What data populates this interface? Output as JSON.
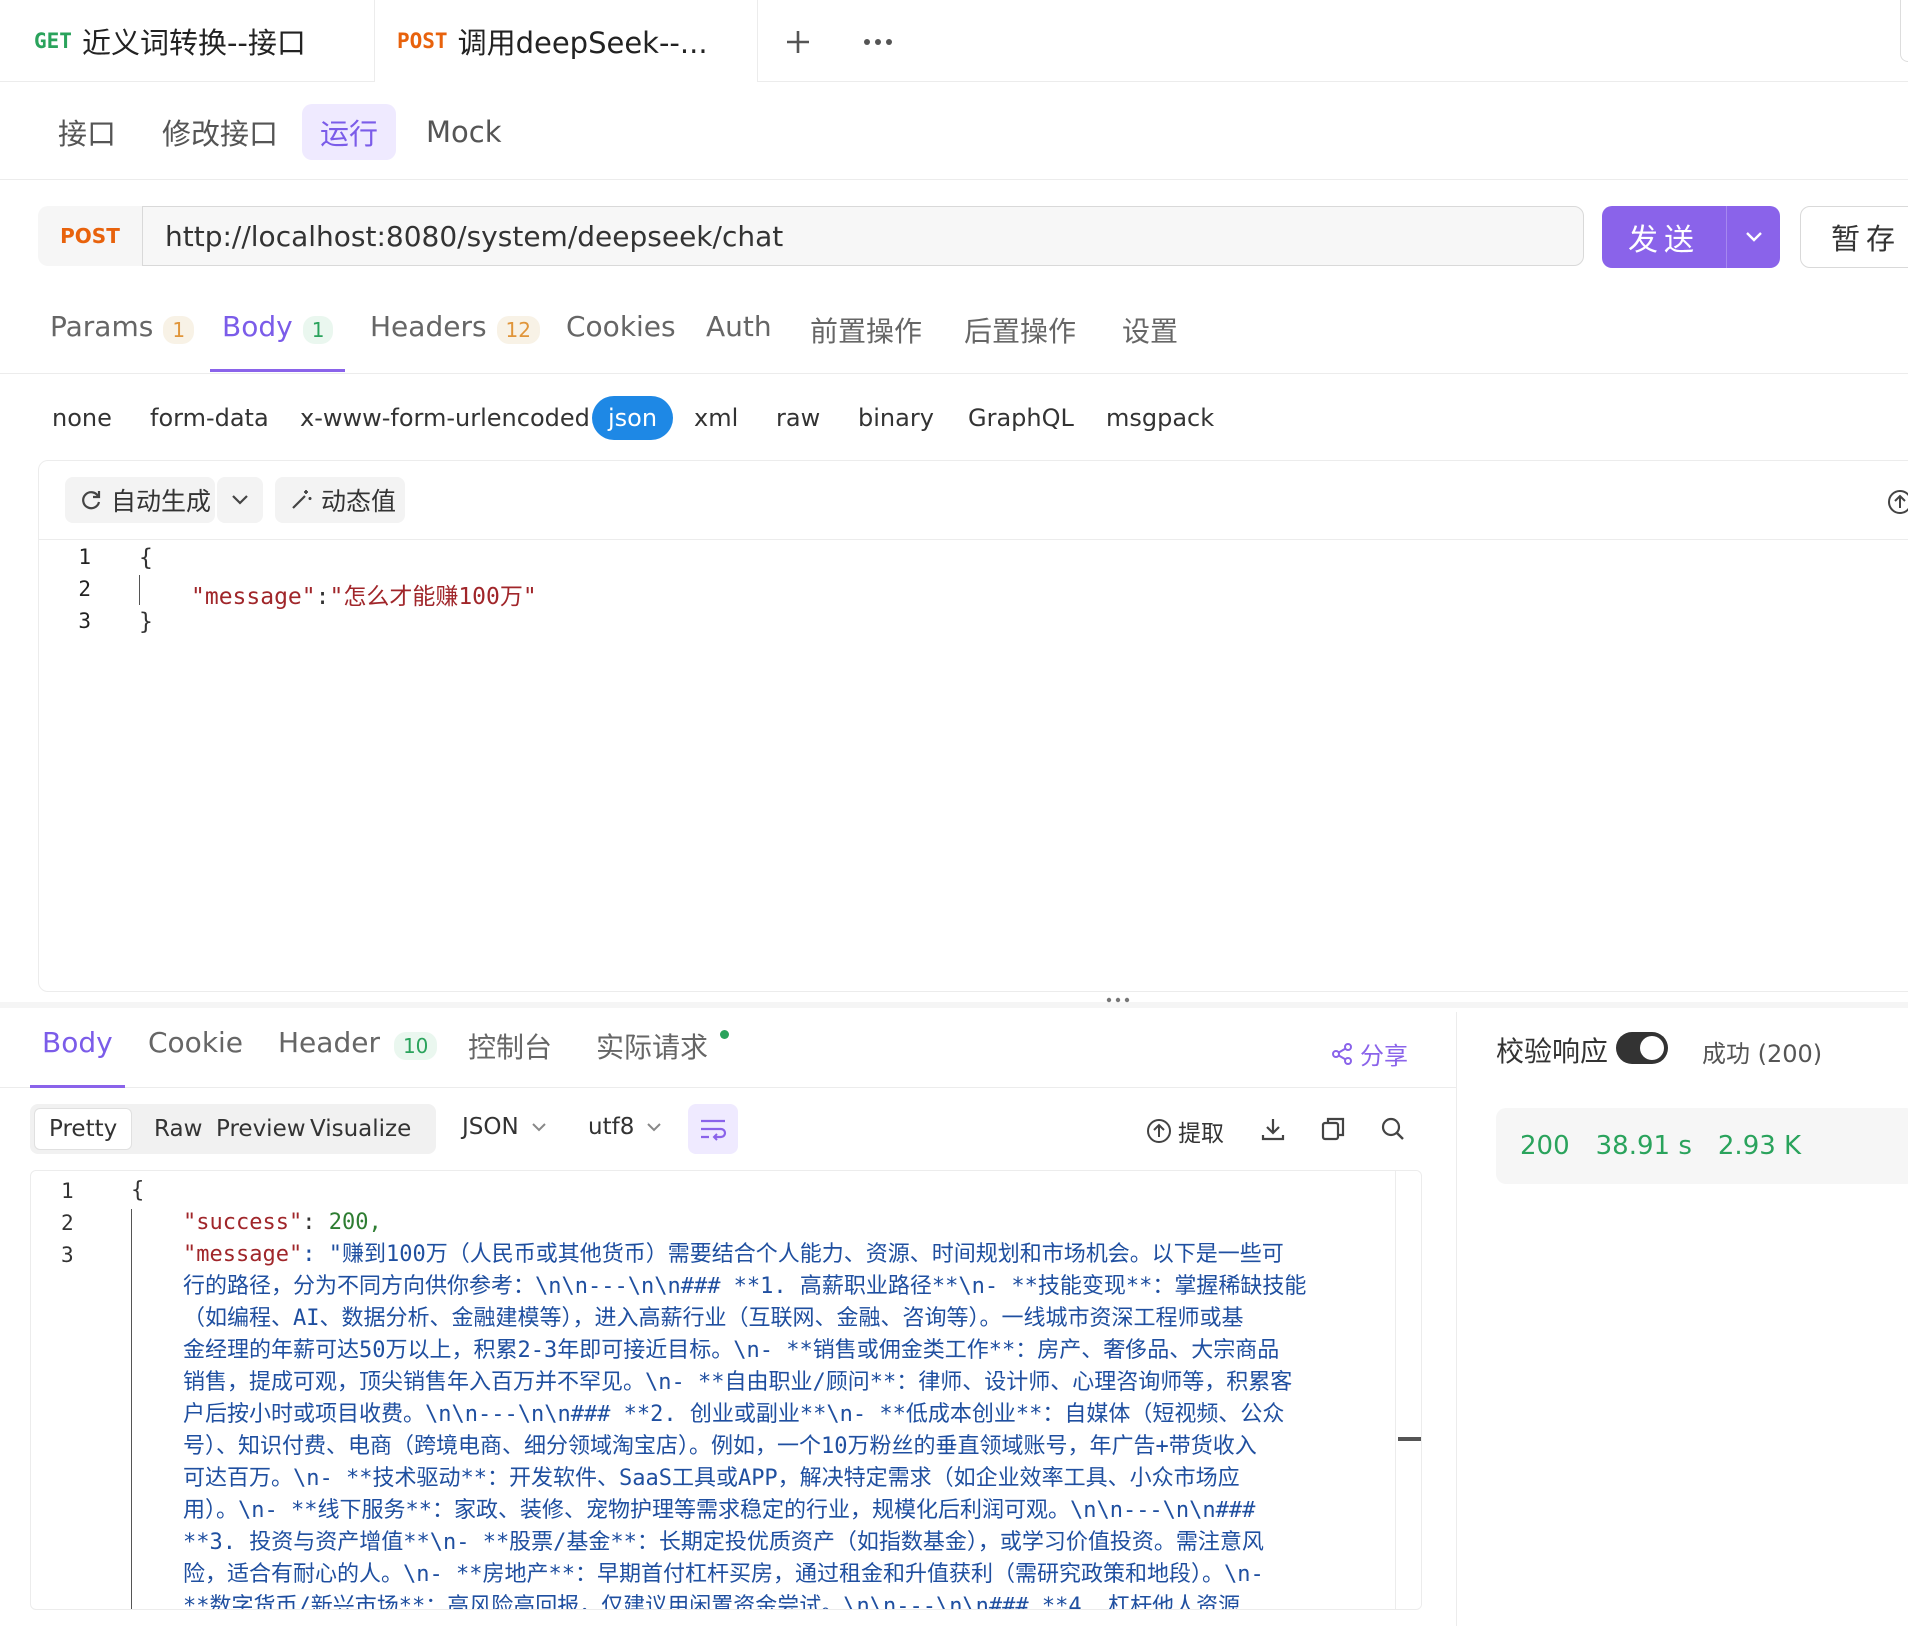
{
  "tabs": [
    {
      "method": "GET",
      "title": "近义词转换--接口"
    },
    {
      "method": "POST",
      "title": "调用deepSeek--..."
    }
  ],
  "subnav": [
    "接口",
    "修改接口",
    "运行",
    "Mock"
  ],
  "request": {
    "method": "POST",
    "url": "http://localhost:8080/system/deepseek/chat",
    "send_label": "发送",
    "save_label": "暂存"
  },
  "request_tabs": [
    {
      "label": "Params",
      "count": "1"
    },
    {
      "label": "Body",
      "count": "1"
    },
    {
      "label": "Headers",
      "count": "12"
    },
    {
      "label": "Cookies"
    },
    {
      "label": "Auth"
    },
    {
      "label": "前置操作"
    },
    {
      "label": "后置操作"
    },
    {
      "label": "设置"
    }
  ],
  "body_types": [
    "none",
    "form-data",
    "x-www-form-urlencoded",
    "json",
    "xml",
    "raw",
    "binary",
    "GraphQL",
    "msgpack"
  ],
  "editor": {
    "auto_generate": "自动生成",
    "dynamic_value": "动态值",
    "lines": [
      "1",
      "2",
      "3"
    ],
    "open_brace": "{",
    "key": "\"message\"",
    "colon": ":",
    "value": "\"怎么才能赚100万\"",
    "close_brace": "}"
  },
  "response_tabs": [
    {
      "label": "Body"
    },
    {
      "label": "Cookie"
    },
    {
      "label": "Header",
      "count": "10"
    },
    {
      "label": "控制台"
    },
    {
      "label": "实际请求"
    }
  ],
  "share_label": "分享",
  "validate": {
    "label": "校验响应",
    "status": "成功 (200)"
  },
  "formats": [
    "Pretty",
    "Raw",
    "Preview",
    "Visualize"
  ],
  "lang_select": "JSON",
  "encoding_select": "utf8",
  "extract_label": "提取",
  "stats": {
    "code": "200",
    "time": "38.91 s",
    "size": "2.93 K"
  },
  "response": {
    "line_numbers": [
      "1",
      "2",
      "3"
    ],
    "open_brace": "{",
    "success_key": "\"success\"",
    "success_val": "200,",
    "message_key": "\"message\"",
    "message_lines": [
      ": \"赚到100万（人民币或其他货币）需要结合个人能力、资源、时间规划和市场机会。以下是一些可",
      "行的路径，分为不同方向供你参考：\\n\\n---\\n\\n### **1. 高薪职业路径**\\n- **技能变现**：掌握稀缺技能",
      "（如编程、AI、数据分析、金融建模等），进入高薪行业（互联网、金融、咨询等）。一线城市资深工程师或基",
      "金经理的年薪可达50万以上，积累2-3年即可接近目标。\\n- **销售或佣金类工作**：房产、奢侈品、大宗商品",
      "销售，提成可观，顶尖销售年入百万并不罕见。\\n- **自由职业/顾问**：律师、设计师、心理咨询师等，积累客",
      "户后按小时或项目收费。\\n\\n---\\n\\n### **2. 创业或副业**\\n- **低成本创业**：自媒体（短视频、公众",
      "号）、知识付费、电商（跨境电商、细分领域淘宝店）。例如，一个10万粉丝的垂直领域账号，年广告+带货收入",
      "可达百万。\\n- **技术驱动**：开发软件、SaaS工具或APP，解决特定需求（如企业效率工具、小众市场应",
      "用）。\\n- **线下服务**：家政、装修、宠物护理等需求稳定的行业，规模化后利润可观。\\n\\n---\\n\\n###",
      "**3. 投资与资产增值**\\n- **股票/基金**：长期定投优质资产（如指数基金），或学习价值投资。需注意风",
      "险，适合有耐心的人。\\n- **房地产**：早期首付杠杆买房，通过租金和升值获利（需研究政策和地段）。\\n-",
      "**数字货币/新兴市场**：高风险高回报，仅建议用闲置资金尝试。\\n\\n---\\n\\n### **4. 杠杆他人资源"
    ]
  }
}
